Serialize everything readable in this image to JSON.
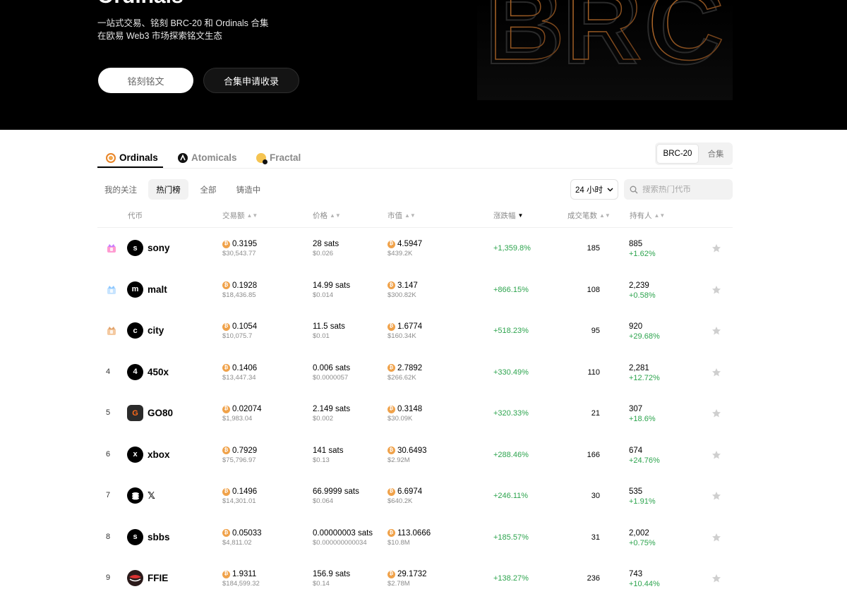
{
  "hero": {
    "title": "Ordinals",
    "subtitle_line1": "一站式交易、铭刻 BRC-20 和 Ordinals 合集",
    "subtitle_line2": "在欧易 Web3 市场探索铭文生态",
    "inscribe_button": "铭刻铭文",
    "apply_button": "合集申请收录",
    "art_text": "BRC"
  },
  "chain_tabs": [
    {
      "label": "Ordinals",
      "active": true
    },
    {
      "label": "Atomicals",
      "active": false
    },
    {
      "label": "Fractal",
      "active": false
    }
  ],
  "standard_toggle": {
    "active": "BRC-20",
    "other": "合集"
  },
  "filter_tabs": [
    "我的关注",
    "热门榜",
    "全部",
    "铸造中"
  ],
  "time_select": "24 小时",
  "search": {
    "placeholder": "搜索热门代币"
  },
  "columns": {
    "token": "代币",
    "volume": "交易额",
    "price": "价格",
    "market_cap": "市值",
    "change": "涨跌幅",
    "trades": "成交笔数",
    "holders": "持有人"
  },
  "colors": {
    "positive": "#2da44e",
    "btc": "#f0a24a",
    "hero_bg": "#000000"
  },
  "rows": [
    {
      "rank": "",
      "rank_icon": "trophy-purple",
      "avatar": "s",
      "name": "sony",
      "volume_btc": "0.3195",
      "volume_usd": "$30,543.77",
      "price": "28 sats",
      "price_usd": "$0.026",
      "mcap_btc": "4.5947",
      "mcap_usd": "$439.2K",
      "change": "+1,359.8%",
      "trades": "185",
      "holders": "885",
      "holders_change": "+1.62%"
    },
    {
      "rank": "",
      "rank_icon": "trophy-blue",
      "avatar": "m",
      "name": "malt",
      "volume_btc": "0.1928",
      "volume_usd": "$18,436.85",
      "price": "14.99 sats",
      "price_usd": "$0.014",
      "mcap_btc": "3.147",
      "mcap_usd": "$300.82K",
      "change": "+866.15%",
      "trades": "108",
      "holders": "2,239",
      "holders_change": "+0.58%"
    },
    {
      "rank": "",
      "rank_icon": "trophy-bronze",
      "avatar": "c",
      "name": "city",
      "volume_btc": "0.1054",
      "volume_usd": "$10,075.7",
      "price": "11.5 sats",
      "price_usd": "$0.01",
      "mcap_btc": "1.6774",
      "mcap_usd": "$160.34K",
      "change": "+518.23%",
      "trades": "95",
      "holders": "920",
      "holders_change": "+29.68%"
    },
    {
      "rank": "4",
      "rank_icon": "",
      "avatar": "4",
      "name": "450x",
      "volume_btc": "0.1406",
      "volume_usd": "$13,447.34",
      "price": "0.006 sats",
      "price_usd": "$0.0000057",
      "mcap_btc": "2.7892",
      "mcap_usd": "$266.62K",
      "change": "+330.49%",
      "trades": "110",
      "holders": "2,281",
      "holders_change": "+12.72%"
    },
    {
      "rank": "5",
      "rank_icon": "",
      "avatar": "G",
      "name": "GO80",
      "volume_btc": "0.02074",
      "volume_usd": "$1,983.04",
      "price": "2.149 sats",
      "price_usd": "$0.002",
      "mcap_btc": "0.3148",
      "mcap_usd": "$30.09K",
      "change": "+320.33%",
      "trades": "21",
      "holders": "307",
      "holders_change": "+18.6%"
    },
    {
      "rank": "6",
      "rank_icon": "",
      "avatar": "x",
      "name": "xbox",
      "volume_btc": "0.7929",
      "volume_usd": "$75,796.97",
      "price": "141 sats",
      "price_usd": "$0.13",
      "mcap_btc": "30.6493",
      "mcap_usd": "$2.92M",
      "change": "+288.46%",
      "trades": "166",
      "holders": "674",
      "holders_change": "+24.76%"
    },
    {
      "rank": "7",
      "rank_icon": "",
      "avatar": "",
      "name": "𝕏",
      "volume_btc": "0.1496",
      "volume_usd": "$14,301.01",
      "price": "66.9999 sats",
      "price_usd": "$0.064",
      "mcap_btc": "6.6974",
      "mcap_usd": "$640.2K",
      "change": "+246.11%",
      "trades": "30",
      "holders": "535",
      "holders_change": "+1.91%"
    },
    {
      "rank": "8",
      "rank_icon": "",
      "avatar": "s",
      "name": "sbbs",
      "volume_btc": "0.05033",
      "volume_usd": "$4,811.02",
      "price": "0.00000003 sats",
      "price_usd": "$0.000000000034",
      "mcap_btc": "113.0666",
      "mcap_usd": "$10.8M",
      "change": "+185.57%",
      "trades": "31",
      "holders": "2,002",
      "holders_change": "+0.75%"
    },
    {
      "rank": "9",
      "rank_icon": "",
      "avatar": "",
      "name": "FFIE",
      "volume_btc": "1.9311",
      "volume_usd": "$184,599.32",
      "price": "156.9 sats",
      "price_usd": "$0.14",
      "mcap_btc": "29.1732",
      "mcap_usd": "$2.78M",
      "change": "+138.27%",
      "trades": "236",
      "holders": "743",
      "holders_change": "+10.44%"
    }
  ]
}
